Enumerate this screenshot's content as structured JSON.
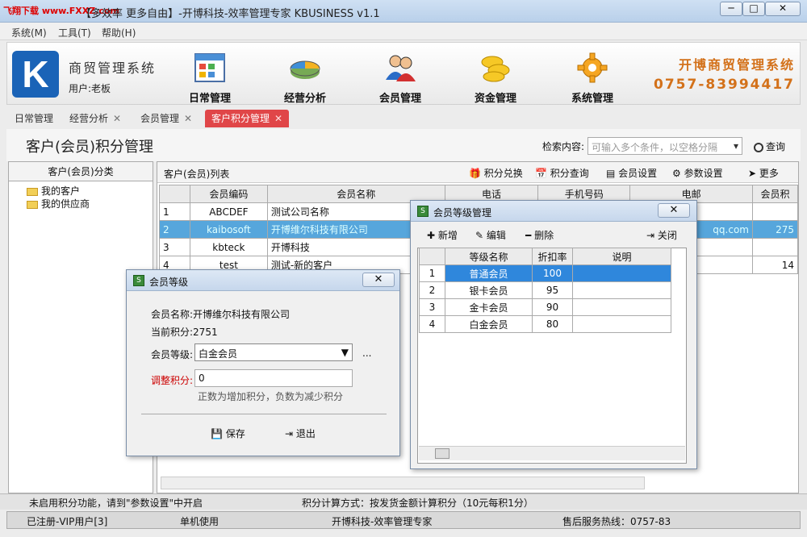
{
  "window": {
    "title": "【多效率 更多自由】-开博科技-效率管理专家 KBUSINESS v1.1",
    "watermark": "飞翔下载 www.FXXZ.com",
    "min": "─",
    "max": "□",
    "close": "✕"
  },
  "menu": [
    "系统(M)",
    "工具(T)",
    "帮助(H)"
  ],
  "app": {
    "logo": "K",
    "name": "商贸管理系统",
    "user": "用户:老板",
    "brand": "开博商贸管理系统",
    "phone": "0757-83994417"
  },
  "toolbar": [
    "日常管理",
    "经营分析",
    "会员管理",
    "资金管理",
    "系统管理"
  ],
  "tabs": [
    {
      "label": "日常管理"
    },
    {
      "label": "经营分析",
      "x": "✕"
    },
    {
      "label": "会员管理",
      "x": "✕"
    },
    {
      "label": "客户积分管理",
      "x": "✕"
    }
  ],
  "page": {
    "title": "客户(会员)积分管理",
    "search_label": "检索内容:",
    "search_placeholder": "可输入多个条件，以空格分隔",
    "search_btn": "查询"
  },
  "left": {
    "header": "客户(会员)分类",
    "items": [
      "我的客户",
      "我的供应商"
    ]
  },
  "right": {
    "header": "客户(会员)列表",
    "buttons": [
      "积分兑换",
      "积分查询",
      "会员设置",
      "参数设置",
      "更多"
    ]
  },
  "grid": {
    "columns": [
      "",
      "会员编码",
      "会员名称",
      "电话",
      "手机号码",
      "电邮",
      "会员积"
    ],
    "rows": [
      [
        "1",
        "ABCDEF",
        "测试公司名称",
        "",
        "",
        "",
        ""
      ],
      [
        "2",
        "kaibosoft",
        "开博维尔科技有限公司",
        "",
        "",
        "qq.com",
        "275"
      ],
      [
        "3",
        "kbteck",
        "开博科技",
        "",
        "",
        "",
        ""
      ],
      [
        "4",
        "test",
        "测试-新的客户",
        "",
        "",
        "",
        "14"
      ]
    ]
  },
  "status1": {
    "left": "未启用积分功能，请到\"参数设置\"中开启",
    "mid": "积分计算方式：按发货金额计算积分（10元每积1分）"
  },
  "status2": {
    "reg": "已注册-VIP用户[3]",
    "mode": "单机使用",
    "company": "开博科技-效率管理专家",
    "hotline": "售后服务热线：0757-83"
  },
  "dlg1": {
    "title": "会员等级",
    "name_label": "会员名称:",
    "name": "开博维尔科技有限公司",
    "points_label": "当前积分:",
    "points": "2751",
    "level_label": "会员等级:",
    "level": "白金会员",
    "adjust_label": "调整积分:",
    "adjust": "0",
    "hint": "正数为增加积分，负数为减少积分",
    "save": "保存",
    "exit": "退出",
    "more": "..."
  },
  "dlg2": {
    "title": "会员等级管理",
    "add": "新增",
    "edit": "编辑",
    "del": "删除",
    "close": "关闭",
    "columns": [
      "",
      "等级名称",
      "折扣率",
      "说明"
    ],
    "rows": [
      [
        "1",
        "普通会员",
        "100",
        ""
      ],
      [
        "2",
        "银卡会员",
        "95",
        ""
      ],
      [
        "3",
        "金卡会员",
        "90",
        ""
      ],
      [
        "4",
        "白金会员",
        "80",
        ""
      ]
    ]
  }
}
